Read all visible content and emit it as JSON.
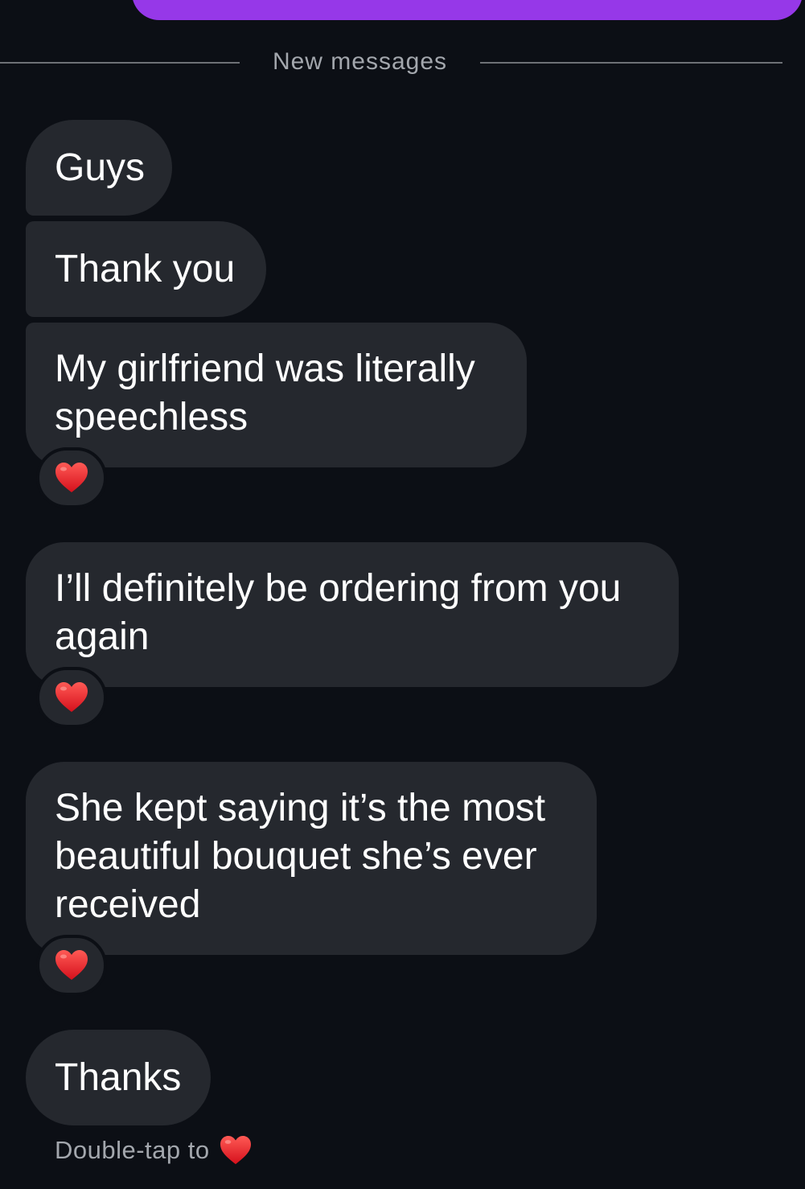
{
  "colors": {
    "background": "#0c0f15",
    "sent_bubble": "#9638e8",
    "received_bubble": "#25282e",
    "divider": "#6e7176",
    "muted_text": "#a3a7ad",
    "heart": "#e8202a"
  },
  "divider": {
    "label": "New messages"
  },
  "messages": [
    {
      "text": "Guys"
    },
    {
      "text": "Thank you"
    },
    {
      "text": "My girlfriend was literally\nspeechless",
      "reaction": "heart-icon"
    },
    {
      "text": "I’ll definitely be ordering from you\nagain",
      "reaction": "heart-icon"
    },
    {
      "text": "She kept saying it’s the most\nbeautiful bouquet she’s ever\nreceived",
      "reaction": "heart-icon"
    },
    {
      "text": "Thanks"
    }
  ],
  "hint": {
    "text": "Double-tap to",
    "icon": "heart-icon"
  }
}
